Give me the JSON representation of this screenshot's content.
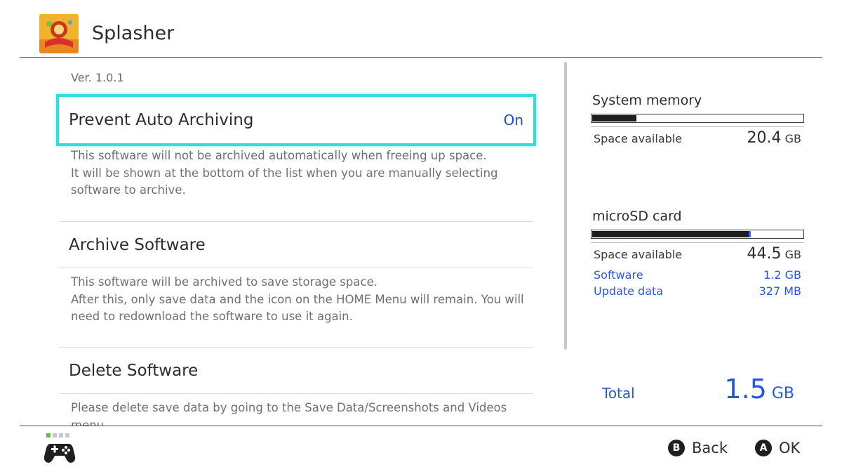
{
  "header": {
    "title": "Splasher",
    "icon": "splasher-game-icon"
  },
  "software": {
    "version": "Ver. 1.0.1",
    "options": [
      {
        "label": "Prevent Auto Archiving",
        "value": "On",
        "description": [
          "This software will not be archived automatically when freeing up space.",
          "It will be shown at the bottom of the list when you are manually selecting",
          "software to archive."
        ]
      },
      {
        "label": "Archive Software",
        "description": [
          "This software will be archived to save storage space.",
          "After this, only save data and the icon on the HOME Menu will remain. You will",
          "need to redownload the software to use it again."
        ]
      },
      {
        "label": "Delete Software",
        "description": [
          "Please delete save data by going to the Save Data/Screenshots and Videos",
          "menu."
        ]
      }
    ]
  },
  "storage": {
    "system": {
      "label": "System memory",
      "used_fraction": 0.21,
      "space_label": "Space available",
      "space_value": "20.4",
      "space_unit": "GB"
    },
    "sd": {
      "label": "microSD card",
      "used_fraction": 0.745,
      "software_fraction": 0.01,
      "space_label": "Space available",
      "space_value": "44.5",
      "space_unit": "GB",
      "software_label": "Software",
      "software_value": "1.2 GB",
      "update_label": "Update data",
      "update_value": "327 MB"
    },
    "total": {
      "label": "Total",
      "value": "1.5",
      "unit": "GB"
    }
  },
  "footer": {
    "controller_icon": "controller-icon",
    "back_key": "B",
    "back_label": "Back",
    "ok_key": "A",
    "ok_label": "OK"
  },
  "colors": {
    "accent": "#2fe0da",
    "link": "#2458e0",
    "player_led": "#59c627"
  }
}
